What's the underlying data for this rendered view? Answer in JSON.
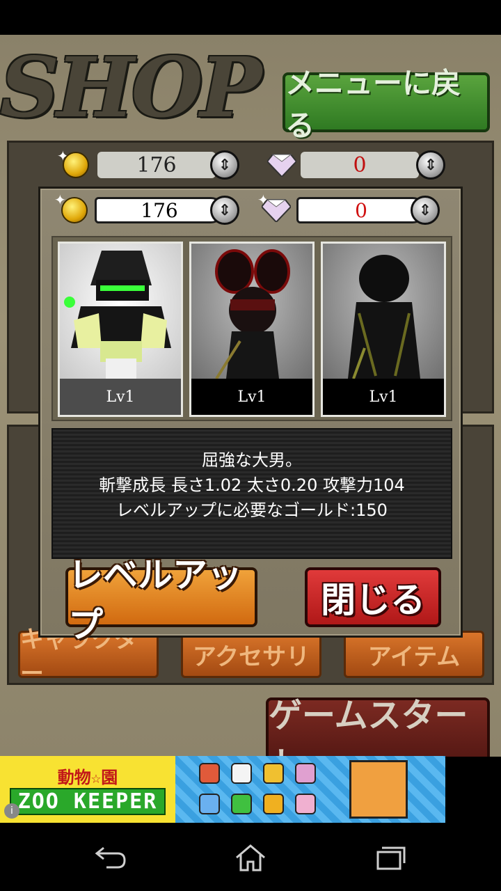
{
  "header": {
    "shop_title": "SHOP",
    "menu_back_label": "メニューに戻る"
  },
  "background": {
    "gold": "176",
    "gems": "0",
    "tabs": [
      "キャラクター",
      "アクセサリ",
      "アイテム"
    ],
    "game_start_label": "ゲームスタート"
  },
  "modal": {
    "gold": "176",
    "gems": "0",
    "characters": [
      {
        "level": "Lv1",
        "selected": true
      },
      {
        "level": "Lv1",
        "selected": false
      },
      {
        "level": "Lv1",
        "selected": false
      }
    ],
    "description": {
      "line1": "屈強な大男。",
      "line2": "斬撃成長 長さ1.02 太さ0.20 攻撃力104",
      "line3": "レベルアップに必要なゴールド:150"
    },
    "levelup_label": "レベルアップ",
    "close_label": "閉じる"
  },
  "ad": {
    "title_top": "動物☆園",
    "title_main": "ZOO KEEPER"
  },
  "colors": {
    "accent_green": "#3a8f2a",
    "accent_orange": "#e08424",
    "accent_red": "#c82020",
    "gem_count_color": "#d01010"
  }
}
